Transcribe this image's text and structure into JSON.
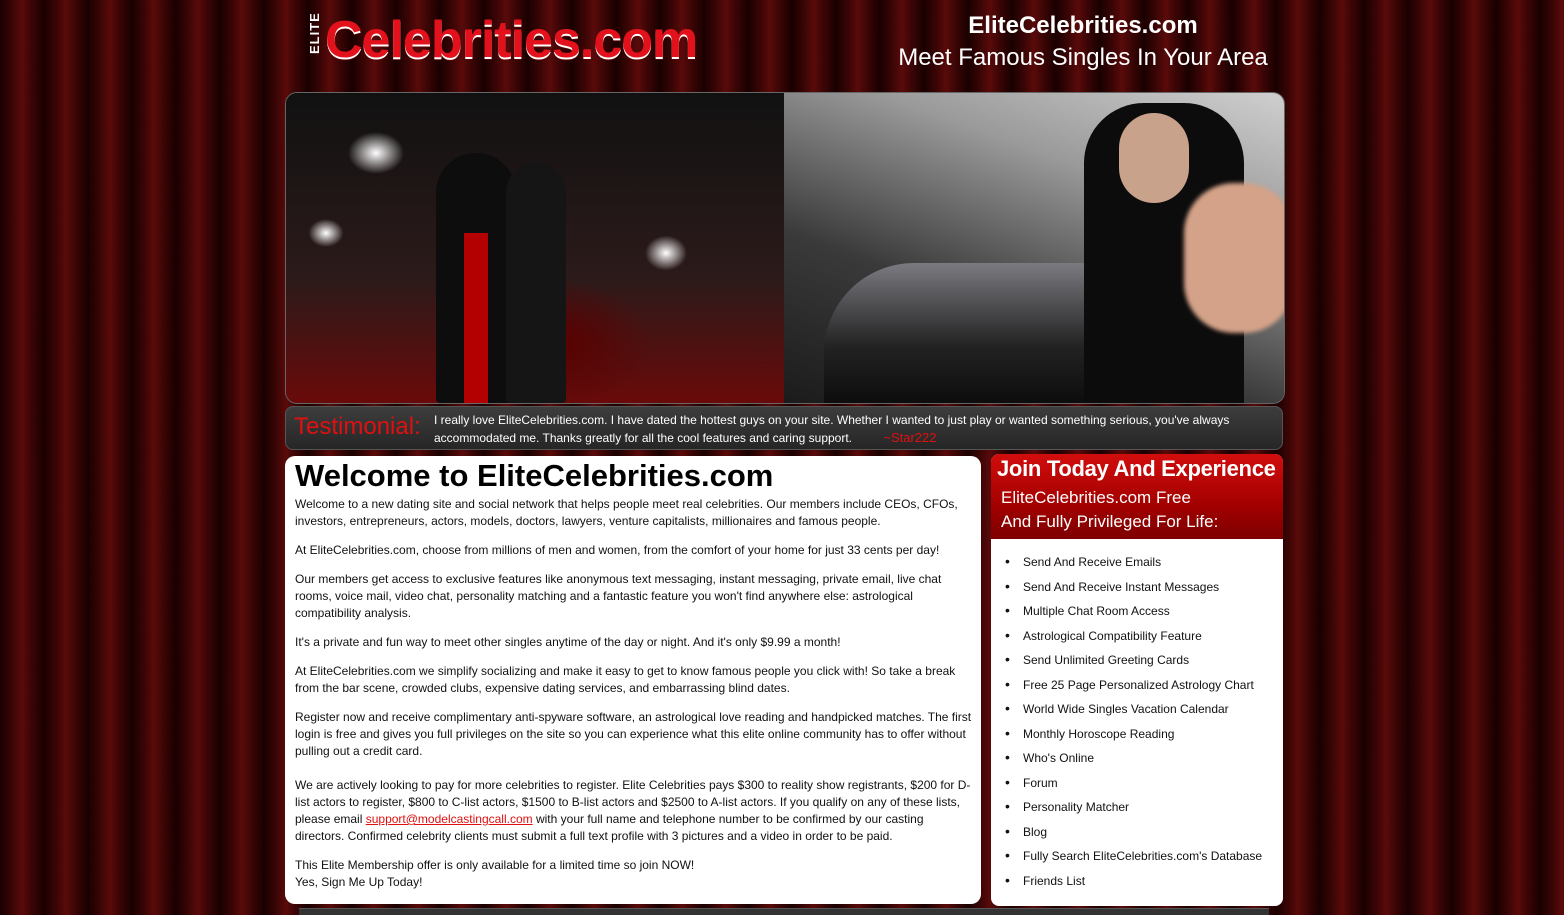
{
  "header": {
    "logo_elite": "ELITE",
    "logo_main": "Celebrities.com",
    "site_name": "EliteCelebrities.com",
    "tagline": "Meet Famous Singles In Your Area"
  },
  "testimonial": {
    "label": "Testimonial:",
    "text": "I really love EliteCelebrities.com. I have dated the hottest guys on your site. Whether I wanted to just play or wanted something serious, you've always accommodated me. Thanks greatly for all the cool features and caring support.",
    "signature": "~Star222"
  },
  "main": {
    "title": "Welcome to EliteCelebrities.com",
    "p1": "Welcome to a new dating site and social network that helps people meet real celebrities. Our members include CEOs, CFOs, investors, entrepreneurs, actors, models, doctors, lawyers, venture capitalists, millionaires and famous people.",
    "p2": "At EliteCelebrities.com, choose from millions of men and women, from the comfort of your home for just 33 cents per day!",
    "p3": "Our members get access to exclusive features like anonymous text messaging, instant messaging, private email, live chat rooms, voice mail, video chat, personality matching and a fantastic feature you won't find anywhere else: astrological compatibility analysis.",
    "p4": "It's a private and fun way to meet other singles anytime of the day or night. And it's only $9.99 a month!",
    "p5": "At EliteCelebrities.com we simplify socializing and make it easy to get to know famous people you click with! So take a break from the bar scene, crowded clubs, expensive dating services, and embarrassing blind dates.",
    "p6": "Register now and receive complimentary anti-spyware software, an astrological love reading and handpicked matches.  The first login is free and gives you full privileges on the site so you can experience what this elite online community has to offer without pulling out a credit card.",
    "p7_before": "We are actively looking to pay for more celebrities to register.  Elite Celebrities pays $300 to reality show registrants, $200 for D-list actors to register, $800 to C-list actors, $1500 to B-list actors and $2500 to A-list actors.  If you qualify on any of these lists, please email ",
    "p7_email": "support@modelcastingcall.com",
    "p7_after": " with your full name and telephone number to be confirmed by our casting directors. Confirmed celebrity clients must submit a full text profile with 3 pictures and a video in order to be paid.",
    "p8_line1": "This Elite Membership offer is only available for a limited time so join NOW!",
    "p8_line2": "Yes, Sign Me Up Today!"
  },
  "side": {
    "heading": "Join Today And Experience",
    "sub1": "EliteCelebrities.com Free",
    "sub2": "And  Fully Privileged For Life:",
    "items": [
      "Send And Receive Emails",
      "Send And Receive Instant Messages",
      "Multiple Chat Room Access",
      "Astrological Compatibility Feature",
      "Send Unlimited Greeting Cards",
      "Free 25 Page Personalized Astrology Chart",
      "World Wide Singles Vacation Calendar",
      "Monthly Horoscope Reading",
      "Who's Online",
      "Forum",
      "Personality Matcher",
      "Blog",
      "Fully Search EliteCelebrities.com's Database",
      "Friends List"
    ]
  }
}
